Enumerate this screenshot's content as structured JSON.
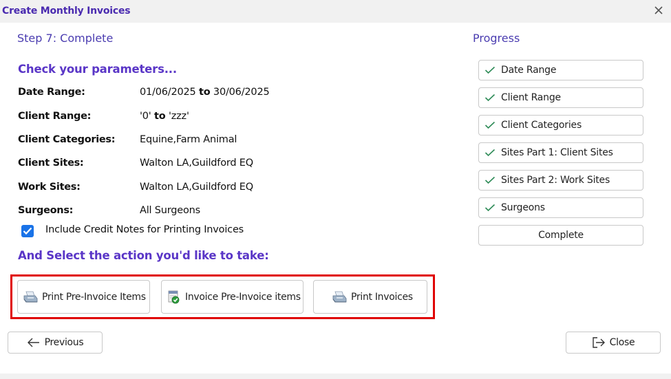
{
  "window": {
    "title": "Create Monthly Invoices"
  },
  "step": {
    "title": "Step 7: Complete"
  },
  "headings": {
    "check": "Check your parameters...",
    "select": "And Select the action you'd like to take:"
  },
  "params": {
    "date_range": {
      "label": "Date Range:",
      "from": "01/06/2025",
      "to_word": "to",
      "to": "30/06/2025"
    },
    "client_range": {
      "label": "Client Range:",
      "from": "'0'",
      "to_word": "to",
      "to": "'zzz'"
    },
    "client_categories": {
      "label": "Client Categories:",
      "value": "Equine,Farm Animal"
    },
    "client_sites": {
      "label": "Client Sites:",
      "value": "Walton LA,Guildford EQ"
    },
    "work_sites": {
      "label": "Work Sites:",
      "value": "Walton LA,Guildford EQ"
    },
    "surgeons": {
      "label": "Surgeons:",
      "value": "All Surgeons"
    }
  },
  "include_credit": {
    "label": "Include Credit Notes for Printing Invoices",
    "checked": true
  },
  "actions": {
    "print_pre": "Print Pre-Invoice Items",
    "invoice_pre": "Invoice Pre-Invoice items",
    "print_invoices": "Print Invoices"
  },
  "nav": {
    "previous": "Previous",
    "close": "Close"
  },
  "progress": {
    "title": "Progress",
    "items": [
      {
        "label": "Date Range",
        "done": true
      },
      {
        "label": "Client Range",
        "done": true
      },
      {
        "label": "Client Categories",
        "done": true
      },
      {
        "label": "Sites Part 1: Client Sites",
        "done": true
      },
      {
        "label": "Sites Part 2: Work Sites",
        "done": true
      },
      {
        "label": "Surgeons",
        "done": true
      },
      {
        "label": "Complete",
        "done": false
      }
    ]
  },
  "colors": {
    "accent": "#5a36c7",
    "title": "#4a2bb0",
    "tick": "#2e8b57",
    "highlight": "#e00000",
    "checkbox": "#1a73e8"
  }
}
